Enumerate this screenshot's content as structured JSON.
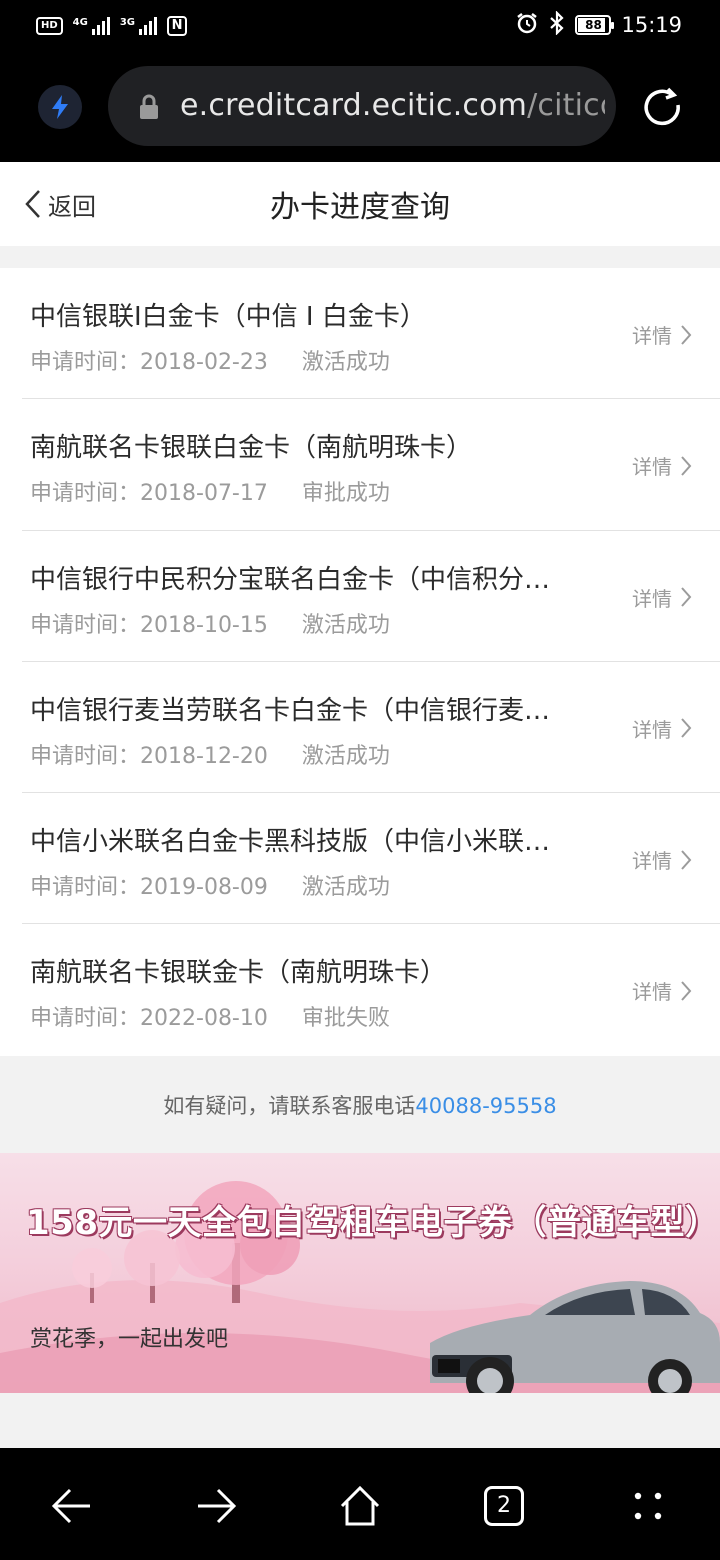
{
  "status_bar": {
    "hd": "HD",
    "sim1_net": "4G",
    "sim2_net": "3G",
    "nfc": "N",
    "battery_percent": 88,
    "battery_text": "88",
    "time": "15:19"
  },
  "browser": {
    "url_main": "e.creditcard.ecitic.com",
    "url_path": "/citicca"
  },
  "header": {
    "back_label": "返回",
    "title": "办卡进度查询"
  },
  "applications": [
    {
      "name": "中信银联I白金卡（中信 I 白金卡）",
      "date_label": "申请时间：",
      "date": "2018-02-23",
      "status": "激活成功",
      "detail_label": "详情"
    },
    {
      "name": "南航联名卡银联白金卡（南航明珠卡）",
      "date_label": "申请时间：",
      "date": "2018-07-17",
      "status": "审批成功",
      "detail_label": "详情"
    },
    {
      "name": "中信银行中民积分宝联名白金卡（中信积分宝联名白金卡）",
      "date_label": "申请时间：",
      "date": "2018-10-15",
      "status": "激活成功",
      "detail_label": "详情"
    },
    {
      "name": "中信银行麦当劳联名卡白金卡（中信银行麦当劳联名卡）",
      "date_label": "申请时间：",
      "date": "2018-12-20",
      "status": "激活成功",
      "detail_label": "详情"
    },
    {
      "name": "中信小米联名白金卡黑科技版（中信小米联名卡）",
      "date_label": "申请时间：",
      "date": "2019-08-09",
      "status": "激活成功",
      "detail_label": "详情"
    },
    {
      "name": "南航联名卡银联金卡（南航明珠卡）",
      "date_label": "申请时间：",
      "date": "2022-08-10",
      "status": "审批失败",
      "detail_label": "详情"
    }
  ],
  "help": {
    "text": "如有疑问，请联系客服电话",
    "phone": "40088-95558"
  },
  "banner": {
    "headline": "158元一天全包自驾租车电子券（普通车型）",
    "subline": "赏花季，一起出发吧"
  },
  "nav": {
    "tab_count": "2"
  },
  "colors": {
    "link": "#3a8ee6",
    "accent_bolt": "#2f7cf6"
  }
}
